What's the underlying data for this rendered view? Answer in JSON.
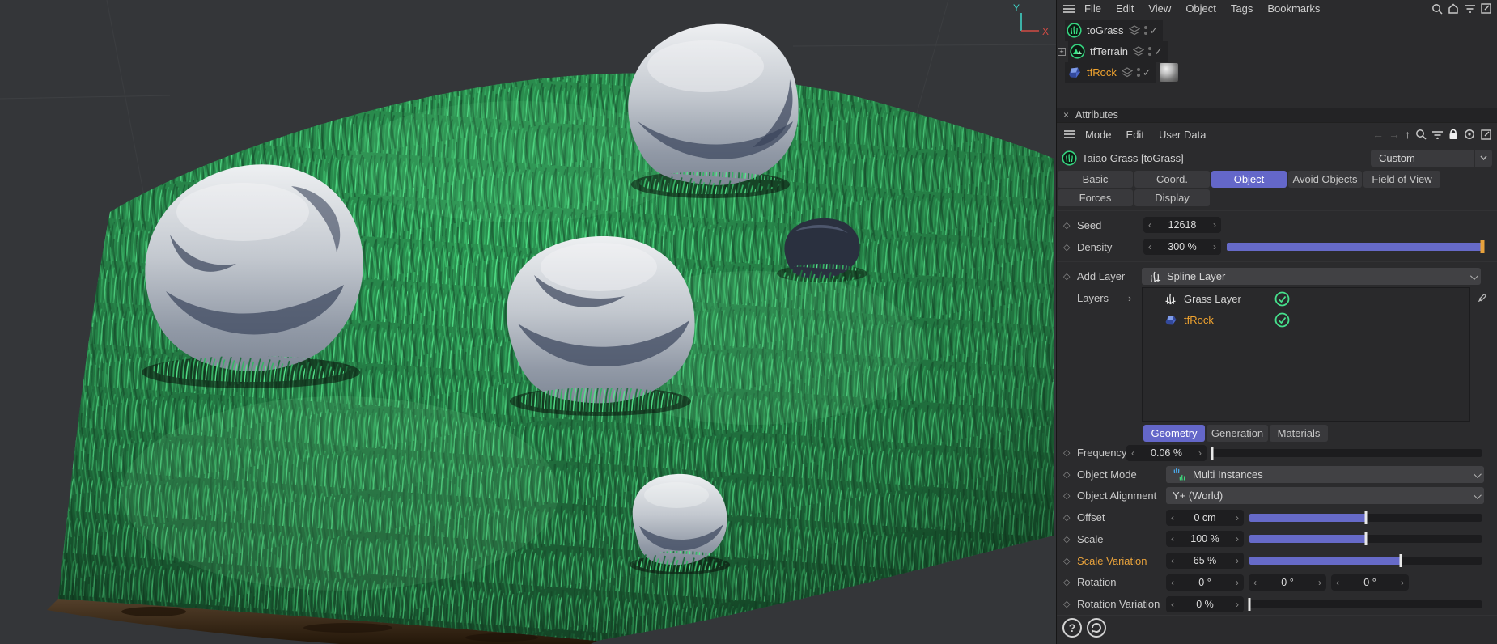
{
  "icons": {
    "close": "×",
    "spin_left": "‹",
    "spin_right": "›",
    "diamond": "◇",
    "check": "✓",
    "layers_expander": "›",
    "back_arrow": "←",
    "forward_arrow": "→",
    "up_arrow": "↑",
    "help": "?",
    "expand_plus": "+"
  },
  "viewport": {
    "axis_y_label": "Y",
    "axis_x_label": "X"
  },
  "object_manager": {
    "menu": [
      "File",
      "Edit",
      "View",
      "Object",
      "Tags",
      "Bookmarks"
    ],
    "objects": [
      {
        "name": "toGrass"
      },
      {
        "name": "tfTerrain"
      },
      {
        "name": "tfRock",
        "selected": true
      }
    ]
  },
  "attributes": {
    "title": "Attributes",
    "menu": [
      "Mode",
      "Edit",
      "User Data"
    ],
    "object_title": "Taiao Grass [toGrass]",
    "preset": "Custom",
    "tabs_row1": [
      "Basic",
      "Coord.",
      "Object",
      "Avoid Objects",
      "Field of View"
    ],
    "tabs_row2": [
      "Forces",
      "Display"
    ],
    "active_tab": "Object",
    "seed": {
      "label": "Seed",
      "value": "12618"
    },
    "density": {
      "label": "Density",
      "value": "300 %",
      "pct": 100
    },
    "add_layer": {
      "label": "Add Layer",
      "value": "Spline Layer"
    },
    "layers": {
      "label": "Layers",
      "items": [
        {
          "name": "Grass Layer",
          "checked": true
        },
        {
          "name": "tfRock",
          "checked": true,
          "selected": true
        }
      ]
    },
    "sub_tabs": [
      "Geometry",
      "Generation",
      "Materials"
    ],
    "active_sub_tab": "Geometry",
    "frequency": {
      "label": "Frequency",
      "value": "0.06 %",
      "pct": 0
    },
    "object_mode": {
      "label": "Object Mode",
      "value": "Multi Instances"
    },
    "object_alignment": {
      "label": "Object Alignment",
      "value": "Y+ (World)"
    },
    "offset": {
      "label": "Offset",
      "value": "0 cm",
      "pct": 50
    },
    "scale": {
      "label": "Scale",
      "value": "100 %",
      "pct": 50
    },
    "scale_variation": {
      "label": "Scale Variation",
      "value": "65 %",
      "pct": 65
    },
    "rotation": {
      "label": "Rotation",
      "values": [
        "0 °",
        "0 °",
        "0 °"
      ]
    },
    "rotation_variation": {
      "label": "Rotation Variation",
      "value": "0 %",
      "pct": 0
    }
  },
  "colors": {
    "accent_tab": "#6467c9",
    "slider_fill": "#666ac8",
    "orange_handle": "#e8a23c",
    "selected_text": "#f0a32f",
    "check_green": "#46e08c",
    "grass_green": "#2f9b55",
    "axis_y": "#3fd1c4",
    "axis_x": "#d14b44"
  }
}
